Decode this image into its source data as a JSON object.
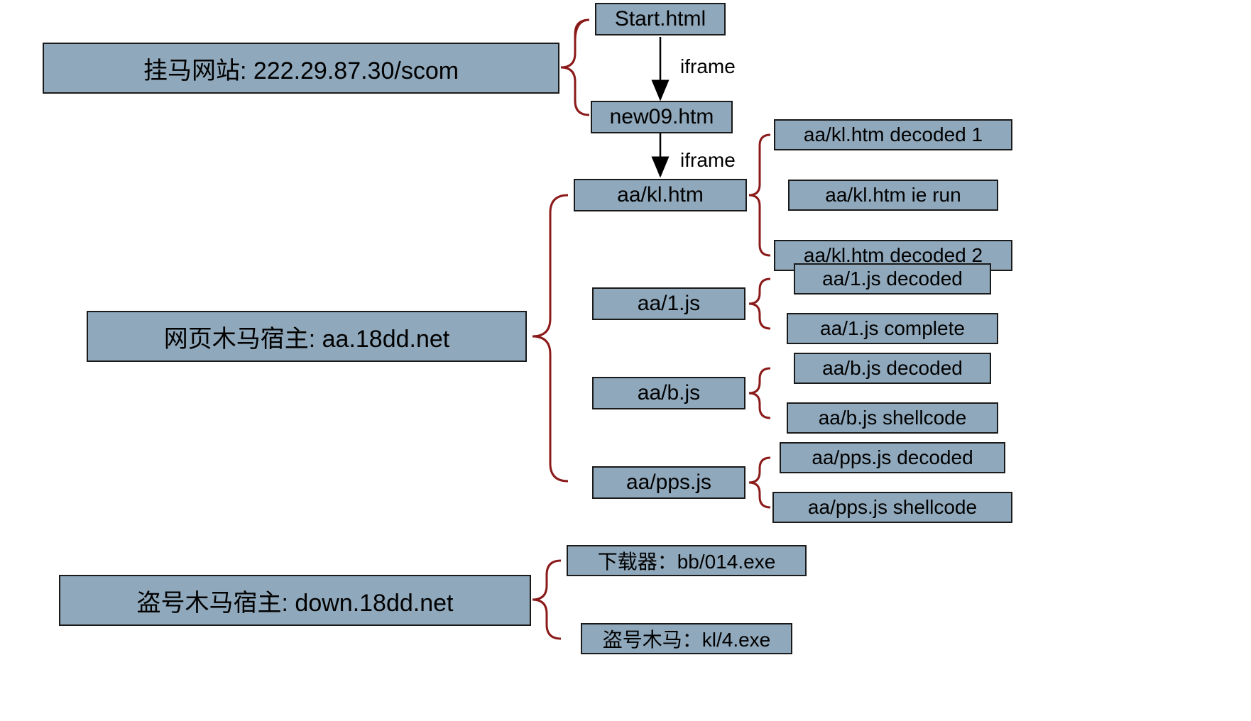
{
  "roots": {
    "site1": "挂马网站: 222.29.87.30/scom",
    "site2": "网页木马宿主: aa.18dd.net",
    "site3": "盗号木马宿主: down.18dd.net"
  },
  "level1": {
    "start_html": "Start.html",
    "new09_htm": "new09.htm"
  },
  "host_files": {
    "kl_htm": "aa/kl.htm",
    "one_js": "aa/1.js",
    "b_js": "aa/b.js",
    "pps_js": "aa/pps.js"
  },
  "kl_details": {
    "d1": "aa/kl.htm decoded 1",
    "ierun": "aa/kl.htm ie run",
    "d2": "aa/kl.htm decoded 2"
  },
  "onejs_details": {
    "d": "aa/1.js decoded",
    "c": "aa/1.js complete"
  },
  "bjs_details": {
    "d": "aa/b.js decoded",
    "sc": "aa/b.js shellcode"
  },
  "ppsjs_details": {
    "d": "aa/pps.js decoded",
    "sc": "aa/pps.js shellcode"
  },
  "down_details": {
    "dl": "下载器：bb/014.exe",
    "trojan": "盗号木马：kl/4.exe"
  },
  "labels": {
    "iframe1": "iframe",
    "iframe2": "iframe"
  },
  "colors": {
    "node_fill": "#8fa8bb",
    "node_border": "#1a1a1a",
    "brace": "#8b1a1a",
    "arrow": "#000000"
  }
}
